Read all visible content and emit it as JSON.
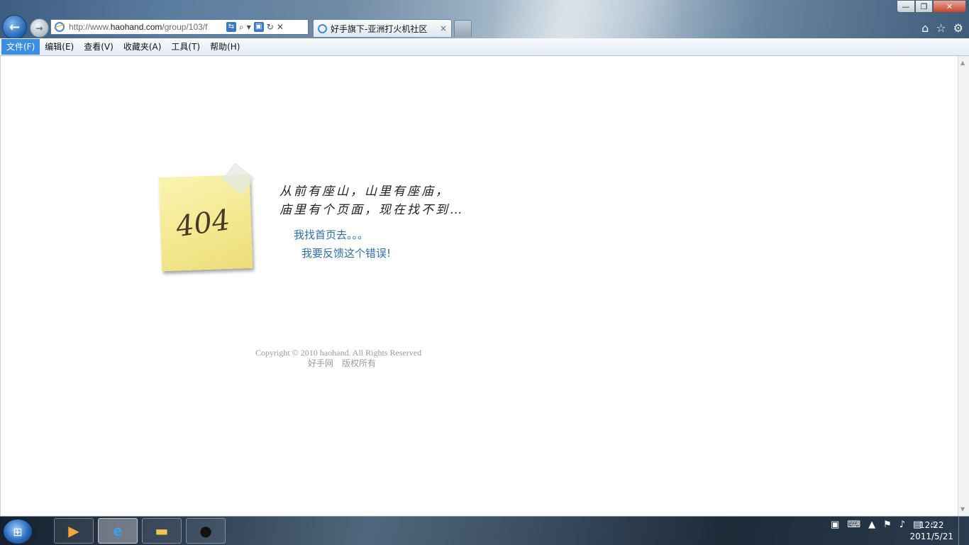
{
  "browser": {
    "url_prefix": "http://www.",
    "url_domain": "haohand.com",
    "url_path": "/group/103/f",
    "tab_title": "好手旗下-亚洲打火机社区",
    "tab_close": "×"
  },
  "window_controls": {
    "minimize": "—",
    "maximize": "❐",
    "close": "✕"
  },
  "menu": [
    {
      "label": "文件(F)"
    },
    {
      "label": "编辑(E)"
    },
    {
      "label": "查看(V)"
    },
    {
      "label": "收藏夹(A)"
    },
    {
      "label": "工具(T)"
    },
    {
      "label": "帮助(H)"
    }
  ],
  "page": {
    "note_text": "404",
    "message_line1": "从前有座山，山里有座庙，",
    "message_line2": "庙里有个页面，现在找不到…",
    "home_link": "我找首页去。。。",
    "feedback_link": "我要反馈这个错误!",
    "copyright": "Copyright © 2010 haohand. All Rights Reserved",
    "rights": "好手网　版权所有"
  },
  "taskbar": {
    "clock_time": "12:22",
    "clock_date": "2011/5/21"
  },
  "colors": {
    "link": "#2c6fae",
    "menu_selected": "#3a8ee6",
    "note_yellow": "#f4e890"
  }
}
